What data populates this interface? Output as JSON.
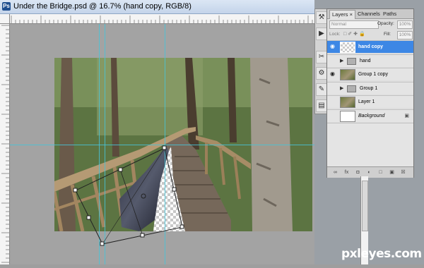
{
  "window": {
    "title": "Under the Bridge.psd @ 16.7% (hand copy, RGB/8)"
  },
  "app": {
    "icon_letters": "Ps"
  },
  "tools": [
    {
      "name": "history-brush-icon",
      "glyph": "⚒"
    },
    {
      "name": "video-icon",
      "glyph": "▶"
    },
    {
      "name": "scissors-icon",
      "glyph": "✂"
    },
    {
      "name": "gear-icon",
      "glyph": "⚙"
    },
    {
      "name": "brush-icon",
      "glyph": "✎"
    },
    {
      "name": "document-icon",
      "glyph": "▤"
    }
  ],
  "layers_panel": {
    "tabs": [
      "Layers ×",
      "Channels",
      "Paths"
    ],
    "active_tab": "Layers",
    "blend_mode": "Normal",
    "opacity_label": "Opacity:",
    "opacity": "100%",
    "lock_label": "Lock:",
    "fill_label": "Fill:",
    "fill": "100%",
    "layers": [
      {
        "name": "hand copy",
        "visible": true,
        "selected": true,
        "kind": "layer",
        "thumb": "checker"
      },
      {
        "name": "hand",
        "visible": false,
        "selected": false,
        "kind": "group"
      },
      {
        "name": "Group 1 copy",
        "visible": true,
        "selected": false,
        "kind": "layer",
        "thumb": "tree"
      },
      {
        "name": "Group 1",
        "visible": false,
        "selected": false,
        "kind": "group"
      },
      {
        "name": "Layer 1",
        "visible": false,
        "selected": false,
        "kind": "layer",
        "thumb": "tree"
      },
      {
        "name": "Background",
        "visible": false,
        "selected": false,
        "kind": "background",
        "thumb": "white",
        "locked": true
      }
    ],
    "footer_icons": [
      "link-icon",
      "fx-icon",
      "mask-icon",
      "adjustment-icon",
      "new-group-icon",
      "new-layer-icon",
      "trash-icon"
    ]
  },
  "colors": {
    "selection": "#3d87e5",
    "guide": "#46c4d8"
  },
  "watermark": "pxleyes.com"
}
